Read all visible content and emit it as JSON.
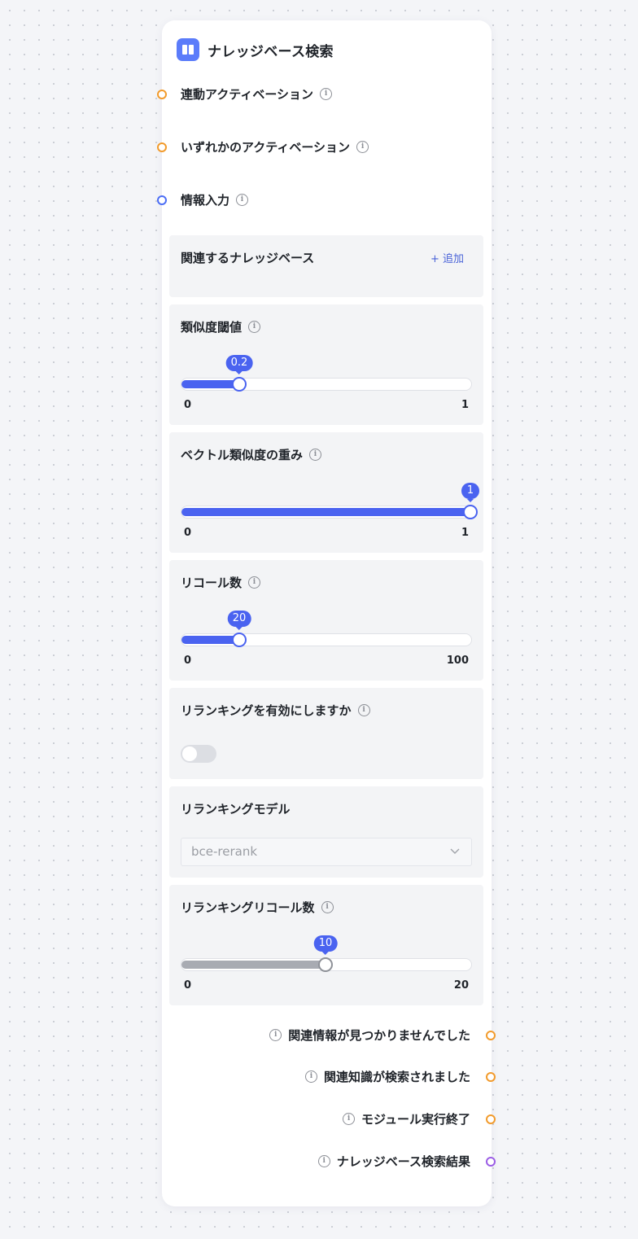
{
  "node": {
    "title": "ナレッジベース検索",
    "icon": "book-icon",
    "accent": "#5b7cfa"
  },
  "inputs": [
    {
      "label": "連動アクティベーション",
      "port_color": "#f29b2c"
    },
    {
      "label": "いずれかのアクティベーション",
      "port_color": "#f29b2c"
    },
    {
      "label": "情報入力",
      "port_color": "#4c6ef5"
    }
  ],
  "knowledge_base": {
    "label": "関連するナレッジベース",
    "add_label": "+ 追加"
  },
  "similarity": {
    "label": "類似度閾値",
    "value": "0.2",
    "min": "0",
    "max": "1",
    "fraction": 0.2
  },
  "vector_weight": {
    "label": "ベクトル類似度の重み",
    "value": "1",
    "min": "0",
    "max": "1",
    "fraction": 1.0
  },
  "recall": {
    "label": "リコール数",
    "value": "20",
    "min": "0",
    "max": "100",
    "fraction": 0.2
  },
  "rerank_toggle": {
    "label": "リランキングを有効にしますか",
    "enabled": false
  },
  "rerank_model": {
    "label": "リランキングモデル",
    "value": "bce-rerank"
  },
  "rerank_recall": {
    "label": "リランキングリコール数",
    "value": "10",
    "min": "0",
    "max": "20",
    "fraction": 0.5
  },
  "outputs": [
    {
      "label": "関連情報が見つかりませんでした",
      "port_color": "#f29b2c"
    },
    {
      "label": "関連知識が検索されました",
      "port_color": "#f29b2c"
    },
    {
      "label": "モジュール実行終了",
      "port_color": "#f29b2c"
    },
    {
      "label": "ナレッジベース検索結果",
      "port_color": "#9b5de5"
    }
  ]
}
